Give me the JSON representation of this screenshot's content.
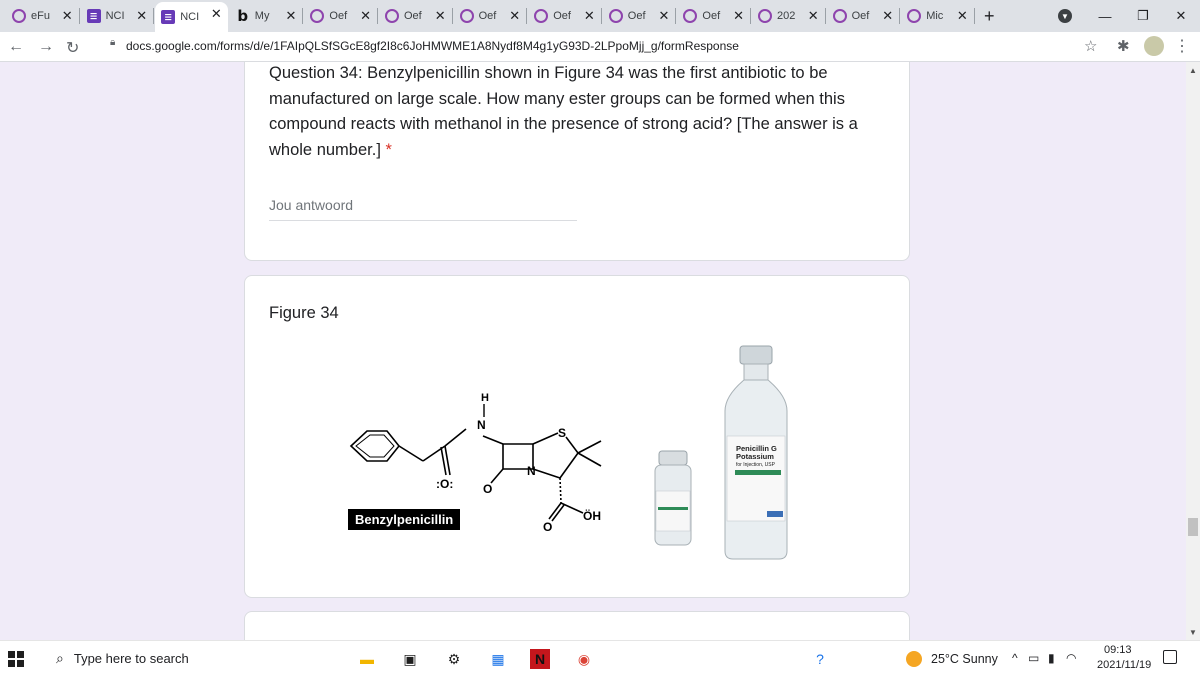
{
  "tabs": [
    {
      "label": "eFu",
      "icon": "wreath-icon"
    },
    {
      "label": "NCI",
      "icon": "forms-icon"
    },
    {
      "label": "NCI",
      "icon": "forms-icon",
      "active": true
    },
    {
      "label": "My",
      "icon": "bing-icon"
    },
    {
      "label": "Oef",
      "icon": "wreath-icon"
    },
    {
      "label": "Oef",
      "icon": "wreath-icon"
    },
    {
      "label": "Oef",
      "icon": "wreath-icon"
    },
    {
      "label": "Oef",
      "icon": "wreath-icon"
    },
    {
      "label": "Oef",
      "icon": "wreath-icon"
    },
    {
      "label": "Oef",
      "icon": "wreath-icon"
    },
    {
      "label": "202",
      "icon": "wreath-icon"
    },
    {
      "label": "Oef",
      "icon": "wreath-icon"
    },
    {
      "label": "Mic",
      "icon": "wreath-icon"
    }
  ],
  "tab_close_glyph": "✕",
  "new_tab_glyph": "+",
  "address_bar": {
    "url": "docs.google.com/forms/d/e/1FAIpQLSfSGcE8gf2I8c6JoHMWME1A8Nydf8M4g1yG93D-2LPpoMjj_g/formResponse"
  },
  "question": {
    "text": "Question 34: Benzylpenicillin shown in Figure 34 was the first antibiotic to be manufactured on large scale. How many ester groups can be formed when this compound reacts with methanol in the presence of strong acid? [The answer is a whole number.]",
    "required_mark": "*",
    "answer_placeholder": "Jou antwoord"
  },
  "figure": {
    "title": "Figure 34",
    "molecule_label": "Benzylpenicillin",
    "atom_labels": {
      "h": "H",
      "n1": "N",
      "s": "S",
      "o1": ":O:",
      "n2": "N",
      "o2": "O",
      "o3": "O",
      "oh": "ÖH"
    },
    "bottle_label_1": "Penicillin G",
    "bottle_label_2": "Potassium",
    "bottle_label_3": "for Injection, USP"
  },
  "taskbar": {
    "search_placeholder": "Type here to search",
    "weather": "25°C  Sunny",
    "time": "09:13",
    "date": "2021/11/19"
  },
  "colors": {
    "page_bg": "#f0ebf8",
    "forms_purple": "#673ab7",
    "required_red": "#d93025"
  }
}
